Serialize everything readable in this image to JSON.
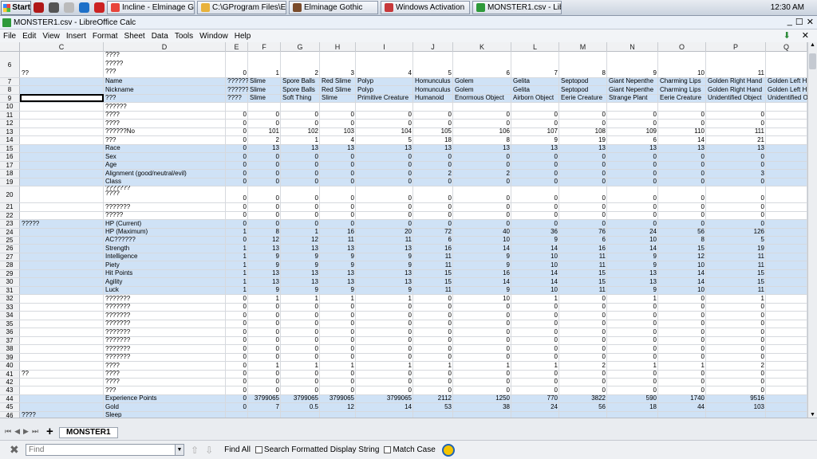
{
  "taskbar": {
    "start": "Start",
    "clock": "12:30 AM",
    "buttons": [
      {
        "label": "Incline - Elminage Go...",
        "color": "#e8453c"
      },
      {
        "label": "C:\\GProgram Files\\El...",
        "color": "#e8b23c"
      },
      {
        "label": "Elminage Gothic",
        "color": "#7a4b2a"
      },
      {
        "label": "Windows Activation",
        "color": "#c7383a"
      },
      {
        "label": "MONSTER1.csv - Lib...",
        "color": "#2e9a3a"
      }
    ]
  },
  "window": {
    "title": "MONSTER1.csv - LibreOffice Calc"
  },
  "menu": [
    "File",
    "Edit",
    "View",
    "Insert",
    "Format",
    "Sheet",
    "Data",
    "Tools",
    "Window",
    "Help"
  ],
  "columns": [
    "C",
    "D",
    "E",
    "F",
    "G",
    "H",
    "I",
    "J",
    "K",
    "L",
    "M",
    "N",
    "O",
    "P",
    "Q"
  ],
  "rows": [
    {
      "n": "6",
      "tall": 1,
      "hl": 0,
      "c": [
        "??",
        "????\n?????\n???",
        "0",
        "1",
        "2",
        "3",
        "4",
        "5",
        "6",
        "7",
        "8",
        "9",
        "10",
        "11",
        ""
      ]
    },
    {
      "n": "7",
      "hl": 1,
      "c": [
        "",
        "Name",
        "??????",
        "Slime",
        "Spore Balls",
        "Red Slime",
        "Polyp",
        "Homunculus",
        "Golem",
        "Gelita",
        "Septopod",
        "Giant Nepenthe",
        "Charming Lips",
        "Golden Right Hand",
        "Golden Left H"
      ]
    },
    {
      "n": "8",
      "hl": 1,
      "c": [
        "",
        "Nickname",
        "??????",
        "Slime",
        "Spore Balls",
        "Red Slime",
        "Polyp",
        "Homunculus",
        "Golem",
        "Gelita",
        "Septopod",
        "Giant Nepenthe",
        "Charming Lips",
        "Golden Right Hand",
        "Golden Left H"
      ]
    },
    {
      "n": "9",
      "hl": 1,
      "sel": 1,
      "c": [
        "",
        "???",
        "????",
        "Slime",
        "Soft Thing",
        "Slime",
        "Primitive Creature",
        "Humanoid",
        "Enormous Object",
        "Airborn Object",
        "Eerie Creature",
        "Strange Plant",
        "Eerie Creature",
        "Unidentified Object",
        "Unidentified O"
      ]
    },
    {
      "n": "10",
      "hl": 0,
      "c": [
        "",
        "??????",
        "",
        "",
        "",
        "",
        "",
        "",
        "",
        "",
        "",
        "",
        "",
        "",
        ""
      ]
    },
    {
      "n": "11",
      "hl": 0,
      "c": [
        "",
        "????",
        "0",
        "0",
        "0",
        "0",
        "0",
        "0",
        "0",
        "0",
        "0",
        "0",
        "0",
        "0",
        ""
      ]
    },
    {
      "n": "12",
      "hl": 0,
      "c": [
        "",
        "????",
        "0",
        "0",
        "0",
        "0",
        "0",
        "0",
        "0",
        "0",
        "0",
        "0",
        "0",
        "0",
        ""
      ]
    },
    {
      "n": "13",
      "hl": 0,
      "c": [
        "",
        "??????No",
        "0",
        "101",
        "102",
        "103",
        "104",
        "105",
        "106",
        "107",
        "108",
        "109",
        "110",
        "111",
        ""
      ]
    },
    {
      "n": "14",
      "hl": 0,
      "c": [
        "",
        "???",
        "0",
        "2",
        "1",
        "4",
        "5",
        "18",
        "8",
        "9",
        "19",
        "6",
        "14",
        "21",
        ""
      ]
    },
    {
      "n": "15",
      "hl": 1,
      "c": [
        "",
        "Race",
        "0",
        "13",
        "13",
        "13",
        "13",
        "13",
        "13",
        "13",
        "13",
        "13",
        "13",
        "13",
        ""
      ]
    },
    {
      "n": "16",
      "hl": 1,
      "c": [
        "",
        "Sex",
        "0",
        "0",
        "0",
        "0",
        "0",
        "0",
        "0",
        "0",
        "0",
        "0",
        "0",
        "0",
        ""
      ]
    },
    {
      "n": "17",
      "hl": 1,
      "c": [
        "",
        "Age",
        "0",
        "0",
        "0",
        "0",
        "0",
        "0",
        "0",
        "0",
        "0",
        "0",
        "0",
        "0",
        ""
      ]
    },
    {
      "n": "18",
      "hl": 1,
      "c": [
        "",
        "Alignment (good/neutral/evil)",
        "0",
        "0",
        "0",
        "0",
        "0",
        "2",
        "2",
        "0",
        "0",
        "0",
        "0",
        "3",
        ""
      ]
    },
    {
      "n": "19",
      "hl": 1,
      "c": [
        "",
        "Class",
        "0",
        "0",
        "0",
        "0",
        "0",
        "0",
        "0",
        "0",
        "0",
        "0",
        "0",
        "0",
        ""
      ]
    },
    {
      "n": "20",
      "tall": 1,
      "hl": 0,
      "c": [
        "",
        "???????\n????",
        "0",
        "0",
        "0",
        "0",
        "0",
        "0",
        "0",
        "0",
        "0",
        "0",
        "0",
        "0",
        ""
      ]
    },
    {
      "n": "21",
      "hl": 0,
      "c": [
        "",
        "???????",
        "0",
        "0",
        "0",
        "0",
        "0",
        "0",
        "0",
        "0",
        "0",
        "0",
        "0",
        "0",
        ""
      ]
    },
    {
      "n": "22",
      "hl": 0,
      "c": [
        "",
        "?????",
        "0",
        "0",
        "0",
        "0",
        "0",
        "0",
        "0",
        "0",
        "0",
        "0",
        "0",
        "0",
        ""
      ]
    },
    {
      "n": "23",
      "hl": 1,
      "c": [
        "?????",
        "HP (Current)",
        "0",
        "0",
        "0",
        "0",
        "0",
        "0",
        "0",
        "0",
        "0",
        "0",
        "0",
        "0",
        ""
      ]
    },
    {
      "n": "24",
      "hl": 1,
      "c": [
        "",
        "HP (Maximum)",
        "1",
        "8",
        "1",
        "16",
        "20",
        "72",
        "40",
        "36",
        "76",
        "24",
        "56",
        "126",
        ""
      ]
    },
    {
      "n": "25",
      "hl": 1,
      "c": [
        "",
        "AC??????",
        "0",
        "12",
        "12",
        "11",
        "11",
        "6",
        "10",
        "9",
        "6",
        "10",
        "8",
        "5",
        ""
      ]
    },
    {
      "n": "26",
      "hl": 1,
      "c": [
        "",
        "Strength",
        "1",
        "13",
        "13",
        "13",
        "13",
        "16",
        "14",
        "14",
        "16",
        "14",
        "15",
        "19",
        ""
      ]
    },
    {
      "n": "27",
      "hl": 1,
      "c": [
        "",
        "Intelligence",
        "1",
        "9",
        "9",
        "9",
        "9",
        "11",
        "9",
        "10",
        "11",
        "9",
        "12",
        "11",
        ""
      ]
    },
    {
      "n": "28",
      "hl": 1,
      "c": [
        "",
        "Piety",
        "1",
        "9",
        "9",
        "9",
        "9",
        "11",
        "9",
        "10",
        "11",
        "9",
        "10",
        "11",
        ""
      ]
    },
    {
      "n": "29",
      "hl": 1,
      "c": [
        "",
        "Hit Points",
        "1",
        "13",
        "13",
        "13",
        "13",
        "15",
        "16",
        "14",
        "15",
        "13",
        "14",
        "15",
        ""
      ]
    },
    {
      "n": "30",
      "hl": 1,
      "c": [
        "",
        "Agility",
        "1",
        "13",
        "13",
        "13",
        "13",
        "15",
        "14",
        "14",
        "15",
        "13",
        "14",
        "15",
        ""
      ]
    },
    {
      "n": "31",
      "hl": 1,
      "c": [
        "",
        "Luck",
        "1",
        "9",
        "9",
        "9",
        "9",
        "11",
        "9",
        "10",
        "11",
        "9",
        "10",
        "11",
        ""
      ]
    },
    {
      "n": "32",
      "hl": 0,
      "c": [
        "",
        "???????",
        "0",
        "1",
        "1",
        "1",
        "1",
        "0",
        "10",
        "1",
        "0",
        "1",
        "0",
        "1",
        ""
      ]
    },
    {
      "n": "33",
      "hl": 0,
      "c": [
        "",
        "???????",
        "0",
        "0",
        "0",
        "0",
        "0",
        "0",
        "0",
        "0",
        "0",
        "0",
        "0",
        "0",
        ""
      ]
    },
    {
      "n": "34",
      "hl": 0,
      "c": [
        "",
        "???????",
        "0",
        "0",
        "0",
        "0",
        "0",
        "0",
        "0",
        "0",
        "0",
        "0",
        "0",
        "0",
        ""
      ]
    },
    {
      "n": "35",
      "hl": 0,
      "c": [
        "",
        "???????",
        "0",
        "0",
        "0",
        "0",
        "0",
        "0",
        "0",
        "0",
        "0",
        "0",
        "0",
        "0",
        ""
      ]
    },
    {
      "n": "36",
      "hl": 0,
      "c": [
        "",
        "???????",
        "0",
        "0",
        "0",
        "0",
        "0",
        "0",
        "0",
        "0",
        "0",
        "0",
        "0",
        "0",
        ""
      ]
    },
    {
      "n": "37",
      "hl": 0,
      "c": [
        "",
        "???????",
        "0",
        "0",
        "0",
        "0",
        "0",
        "0",
        "0",
        "0",
        "0",
        "0",
        "0",
        "0",
        ""
      ]
    },
    {
      "n": "38",
      "hl": 0,
      "c": [
        "",
        "???????",
        "0",
        "0",
        "0",
        "0",
        "0",
        "0",
        "0",
        "0",
        "0",
        "0",
        "0",
        "0",
        ""
      ]
    },
    {
      "n": "39",
      "hl": 0,
      "c": [
        "",
        "???????",
        "0",
        "0",
        "0",
        "0",
        "0",
        "0",
        "0",
        "0",
        "0",
        "0",
        "0",
        "0",
        ""
      ]
    },
    {
      "n": "40",
      "hl": 0,
      "c": [
        "",
        "????",
        "0",
        "1",
        "1",
        "1",
        "1",
        "1",
        "1",
        "1",
        "2",
        "1",
        "1",
        "2",
        ""
      ]
    },
    {
      "n": "41",
      "hl": 0,
      "c": [
        "??",
        "????",
        "0",
        "0",
        "0",
        "0",
        "0",
        "0",
        "0",
        "0",
        "0",
        "0",
        "0",
        "0",
        ""
      ]
    },
    {
      "n": "42",
      "hl": 0,
      "c": [
        "",
        "????",
        "0",
        "0",
        "0",
        "0",
        "0",
        "0",
        "0",
        "0",
        "0",
        "0",
        "0",
        "0",
        ""
      ]
    },
    {
      "n": "43",
      "hl": 0,
      "c": [
        "",
        "???",
        "0",
        "0",
        "0",
        "0",
        "0",
        "0",
        "0",
        "0",
        "0",
        "0",
        "0",
        "0",
        ""
      ]
    },
    {
      "n": "44",
      "hl": 1,
      "c": [
        "",
        "Experience Points",
        "0",
        "3799065",
        "3799065",
        "3799065",
        "3799065",
        "2112",
        "1250",
        "770",
        "3822",
        "590",
        "1740",
        "9516",
        ""
      ]
    },
    {
      "n": "45",
      "hl": 1,
      "c": [
        "",
        "Gold",
        "0",
        "7",
        "0.5",
        "12",
        "14",
        "53",
        "38",
        "24",
        "56",
        "18",
        "44",
        "103",
        ""
      ]
    },
    {
      "n": "46",
      "hl": 1,
      "c": [
        "????",
        "Sleep",
        "",
        "",
        "",
        "",
        "",
        "",
        "",
        "",
        "",
        "",
        "",
        "",
        ""
      ]
    }
  ],
  "sheet_tab": "MONSTER1",
  "find": {
    "placeholder": "Find",
    "find_all": "Find All",
    "search_formatted": "Search Formatted Display String",
    "match_case": "Match Case"
  }
}
